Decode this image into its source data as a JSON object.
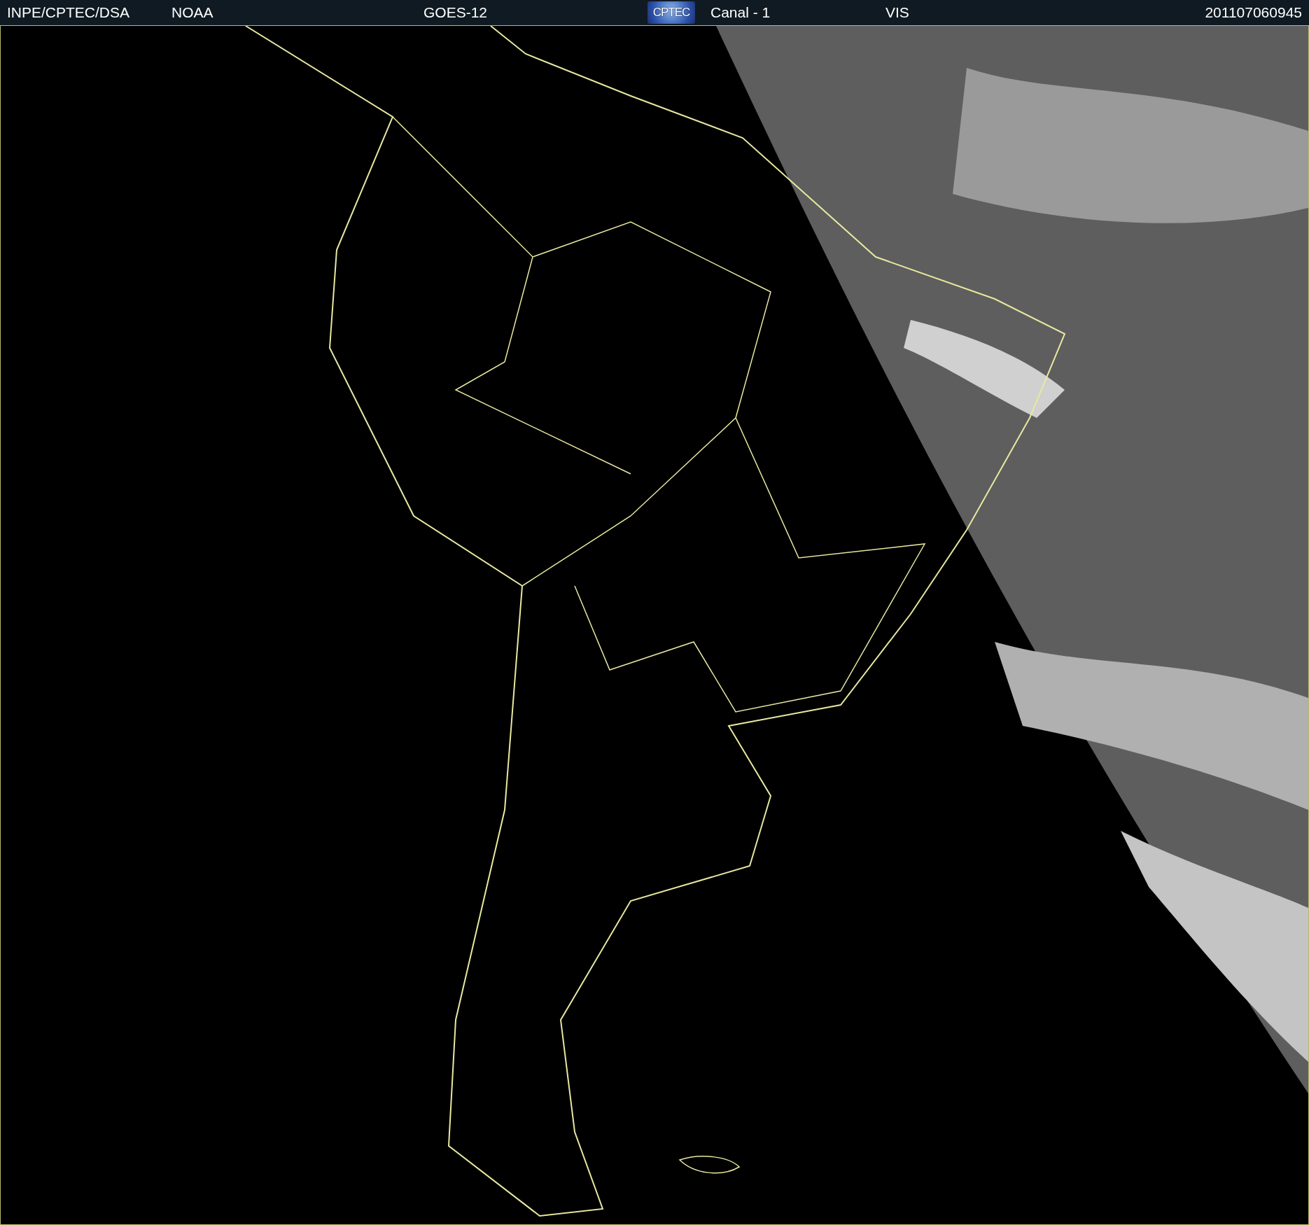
{
  "header": {
    "items": [
      {
        "kind": "text",
        "text": "INPE/CPTEC/DSA"
      },
      {
        "kind": "text",
        "text": "NOAA"
      },
      {
        "kind": "text",
        "text": "GOES-12"
      },
      {
        "kind": "logo",
        "text": "CPTEC"
      },
      {
        "kind": "text",
        "text": "Canal - 1"
      },
      {
        "kind": "text",
        "text": "VIS"
      },
      {
        "kind": "text",
        "text": "201107060945"
      }
    ]
  }
}
